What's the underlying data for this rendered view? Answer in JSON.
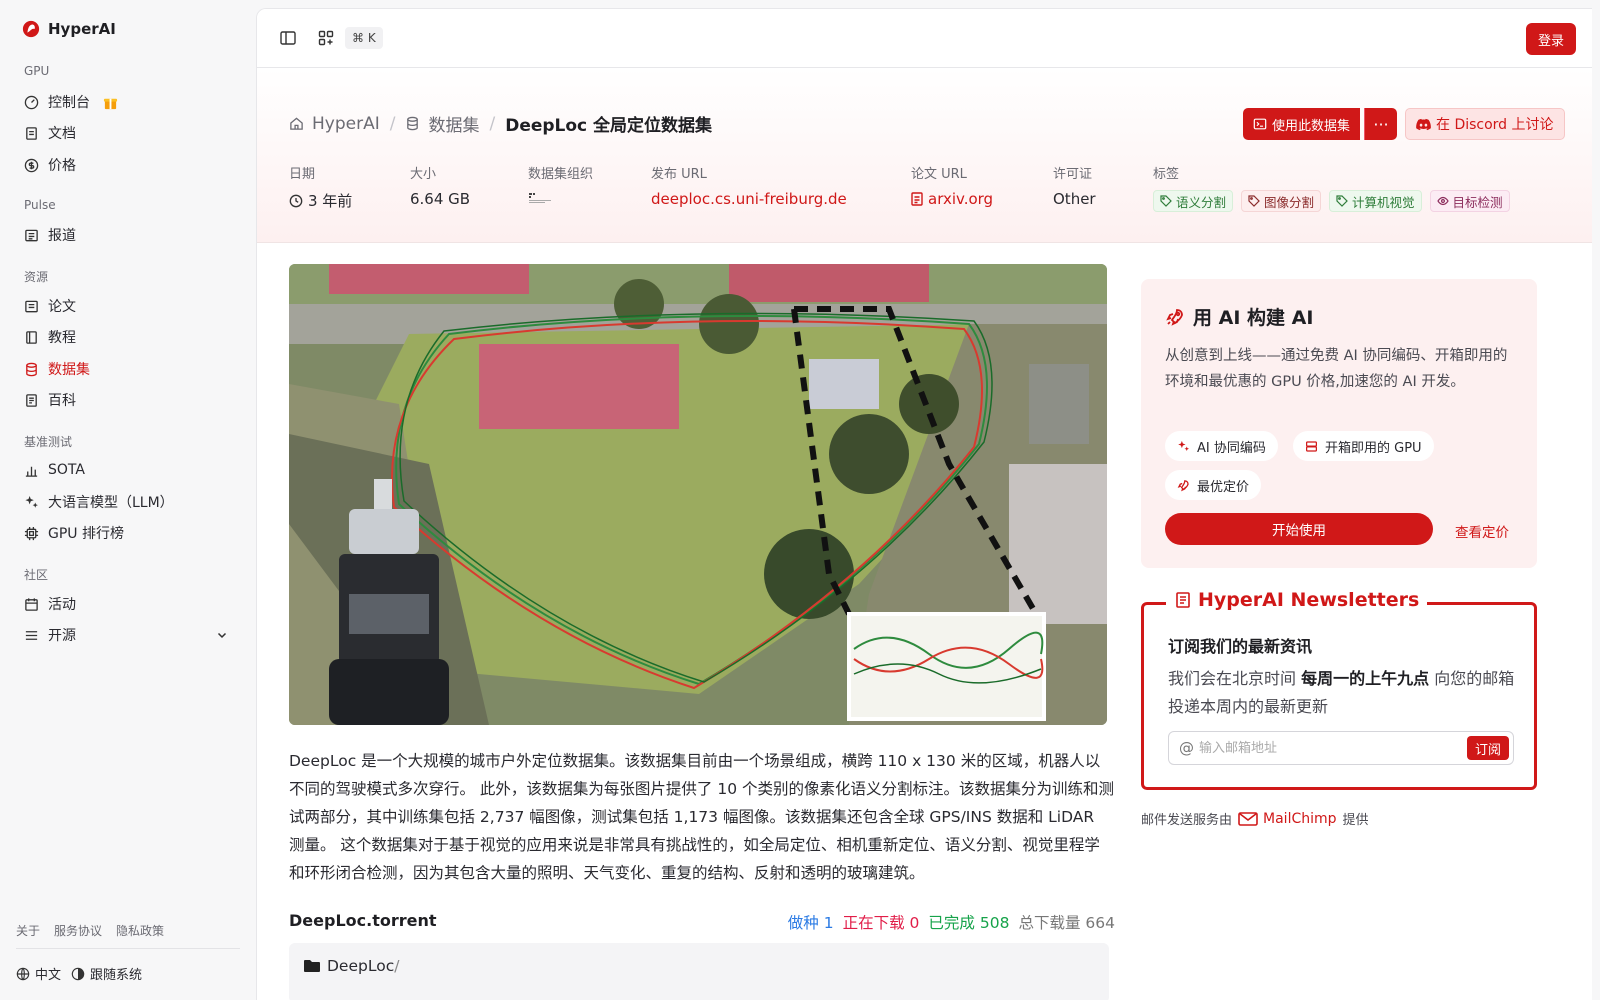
{
  "brand": {
    "name": "HyperAI"
  },
  "sidebar": {
    "sections": [
      "GPU",
      "Pulse",
      "资源",
      "基准测试",
      "社区"
    ],
    "items": [
      {
        "label": "控制台"
      },
      {
        "label": "文档"
      },
      {
        "label": "价格"
      },
      {
        "label": "报道"
      },
      {
        "label": "论文"
      },
      {
        "label": "教程"
      },
      {
        "label": "数据集"
      },
      {
        "label": "百科"
      },
      {
        "label": "SOTA"
      },
      {
        "label": "大语言模型（LLM）"
      },
      {
        "label": "GPU 排行榜"
      },
      {
        "label": "活动"
      },
      {
        "label": "开源"
      }
    ],
    "footer_links": [
      "关于",
      "服务协议",
      "隐私政策"
    ],
    "language": "中文",
    "theme": "跟随系统"
  },
  "topbar": {
    "shortcut": "⌘ K",
    "login": "登录"
  },
  "breadcrumb": {
    "home": "HyperAI",
    "section": "数据集",
    "current": "DeepLoc 全局定位数据集"
  },
  "actions": {
    "use_dataset": "使用此数据集",
    "more": "···",
    "discord": "在 Discord 上讨论"
  },
  "meta": {
    "date_label": "日期",
    "date_value": "3 年前",
    "size_label": "大小",
    "size_value": "6.64 GB",
    "org_label": "数据集组织",
    "pub_url_label": "发布 URL",
    "pub_url_value": "deeploc.cs.uni-freiburg.de",
    "paper_url_label": "论文 URL",
    "paper_url_value": "arxiv.org",
    "license_label": "许可证",
    "license_value": "Other",
    "tags_label": "标签",
    "tags": [
      "语义分割",
      "图像分割",
      "计算机视觉",
      "目标检测"
    ]
  },
  "description": "DeepLoc 是一个大规模的城市户外定位数据集。该数据集目前由一个场景组成，横跨 110 x 130 米的区域，机器人以不同的驾驶模式多次穿行。 此外，该数据集为每张图片提供了 10 个类别的像素化语义分割标注。该数据集分为训练和测试两部分，其中训练集包括 2,737 幅图像，测试集包括 1,173 幅图像。该数据集还包含全球 GPS/INS 数据和 LiDAR 测量。 这个数据集对于基于视觉的应用来说是非常具有挑战性的，如全局定位、相机重新定位、语义分割、视觉里程学和环形闭合检测，因为其包含大量的照明、天气变化、重复的结构、反射和透明的玻璃建筑。",
  "torrent": {
    "title": "DeepLoc.torrent",
    "seed_label": "做种",
    "seed": "1",
    "downloading_label": "正在下载",
    "downloading": "0",
    "done_label": "已完成",
    "done": "508",
    "total_label": "总下载量",
    "total": "664",
    "folder": "DeepLoc",
    "folder_suffix": "/"
  },
  "promo": {
    "title": "用 AI 构建 AI",
    "text": "从创意到上线——通过免费 AI 协同编码、开箱即用的环境和最优惠的 GPU 价格,加速您的 AI 开发。",
    "chips": [
      "AI 协同编码",
      "开箱即用的 GPU",
      "最优定价"
    ],
    "start": "开始使用",
    "pricing": "查看定价"
  },
  "newsletter": {
    "title": "HyperAI Newsletters",
    "heading": "订阅我们的最新资讯",
    "text_pre": "我们会在北京时间 ",
    "text_bold": "每周一的上午九点",
    "text_post": " 向您的邮箱投递本周内的最新更新",
    "placeholder": "输入邮箱地址",
    "subscribe": "订阅"
  },
  "mail_service": {
    "pre": "邮件发送服务由",
    "brand": "MailChimp",
    "post": "提供"
  },
  "colors": {
    "accent": "#d01818"
  }
}
